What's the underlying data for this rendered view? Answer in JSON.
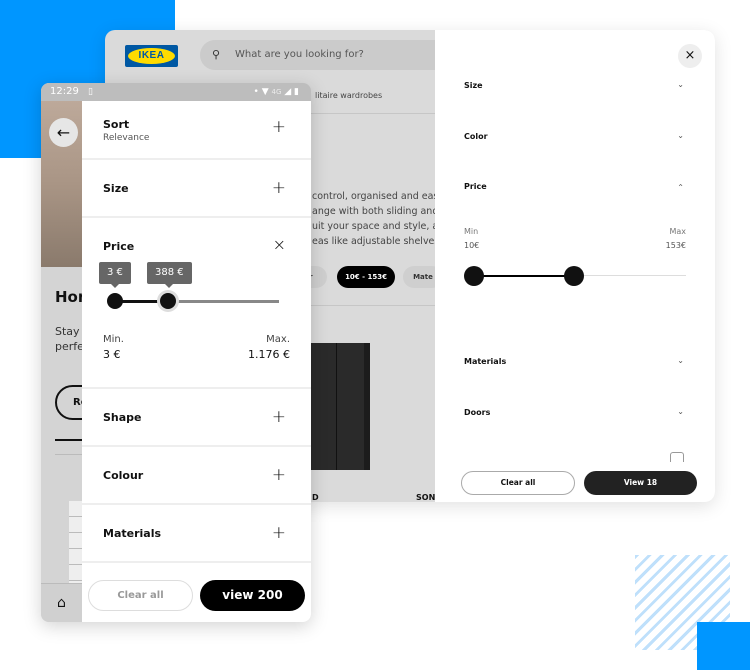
{
  "colors": {
    "accent": "#0096ff",
    "ikea_blue": "#0058a3",
    "ikea_yellow": "#ffdb00"
  },
  "desktop": {
    "logo_text": "IKEA",
    "search_placeholder": "What are you looking for?",
    "breadcrumb": "litaire wardrobes",
    "description": [
      "control, organised and easy t",
      "ange with both sliding and",
      "uit your space and style, a ch",
      "eas like adjustable shelves."
    ],
    "chips": [
      "or",
      "10€ - 153€",
      "Mate"
    ],
    "product_labels": [
      "D",
      "SON"
    ],
    "panel": {
      "sections": [
        {
          "label": "Size",
          "icon": "chevron-down"
        },
        {
          "label": "Color",
          "icon": "chevron-down"
        },
        {
          "label": "Price",
          "icon": "chevron-up"
        },
        {
          "label": "Materials",
          "icon": "chevron-down"
        },
        {
          "label": "Doors",
          "icon": "chevron-down"
        }
      ],
      "price": {
        "min_label": "Min",
        "max_label": "Max",
        "min_value": "10€",
        "max_value": "153€",
        "slider_low": 0,
        "slider_high": 0.45
      },
      "clear_label": "Clear all",
      "view_label": "View 18"
    }
  },
  "mobile": {
    "time": "12:29",
    "network": "4G",
    "bg_title": "Hon",
    "bg_text": [
      "Stay c",
      "perfe"
    ],
    "bg_button": "Re",
    "sections": [
      {
        "label": "Sort",
        "sub": "Relevance",
        "icon": "+"
      },
      {
        "label": "Size",
        "icon": "+"
      },
      {
        "label": "Price",
        "icon": "×"
      },
      {
        "label": "Shape",
        "icon": "+"
      },
      {
        "label": "Colour",
        "icon": "+"
      },
      {
        "label": "Materials",
        "icon": "+"
      }
    ],
    "price": {
      "low_tip": "3 €",
      "high_tip": "388 €",
      "min_label": "Min.",
      "max_label": "Max.",
      "min_value": "3 €",
      "max_value": "1.176 €",
      "slider_low": 0,
      "slider_high": 0.33
    },
    "clear_label": "Clear all",
    "view_label": "view 200"
  }
}
